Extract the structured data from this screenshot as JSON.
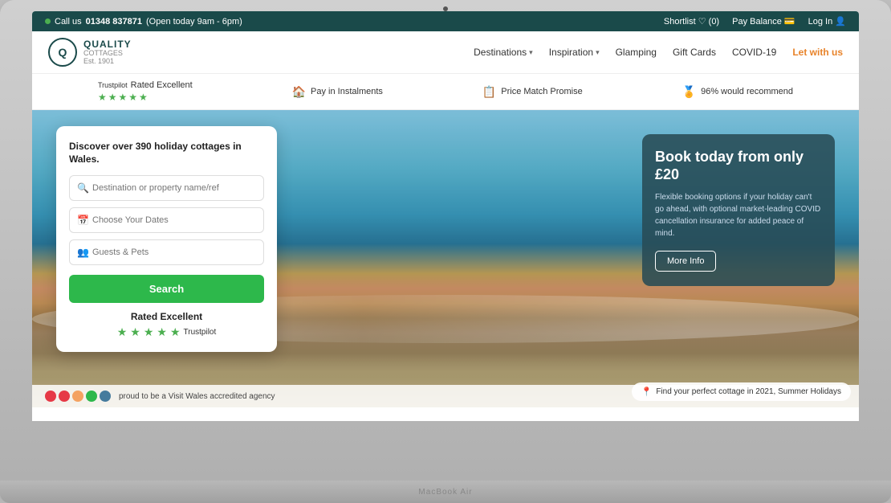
{
  "laptop": {
    "brand_label": "MacBook Air"
  },
  "topbar": {
    "call_label": "Call us",
    "phone": "01348 837871",
    "hours": "(Open today 9am - 6pm)",
    "shortlist": "Shortlist",
    "shortlist_count": "(0)",
    "pay_balance": "Pay Balance",
    "login": "Log In"
  },
  "nav": {
    "logo_letter": "Q",
    "brand_name": "QUALITY",
    "brand_sub": "COTTAGES",
    "established": "Est. 1901",
    "links": [
      {
        "label": "Destinations",
        "has_chevron": true
      },
      {
        "label": "Inspiration",
        "has_chevron": true
      },
      {
        "label": "Glamping",
        "has_chevron": false
      },
      {
        "label": "Gift Cards",
        "has_chevron": false
      },
      {
        "label": "COVID-19",
        "has_chevron": false
      },
      {
        "label": "Let with us",
        "has_chevron": false,
        "highlight": true
      }
    ]
  },
  "trustbar": {
    "items": [
      {
        "icon": "★",
        "label": "Rated Excellent",
        "type": "trustpilot"
      },
      {
        "icon": "◎",
        "label": "Pay in Instalments",
        "type": "generic"
      },
      {
        "icon": "▦",
        "label": "Price Match Promise",
        "type": "generic"
      },
      {
        "icon": "◎",
        "label": "96% would recommend",
        "type": "generic"
      }
    ]
  },
  "search_card": {
    "title": "Discover over 390 holiday cottages in Wales.",
    "destination_placeholder": "Destination or property name/ref",
    "dates_placeholder": "Choose Your Dates",
    "guests_placeholder": "Guests & Pets",
    "search_label": "Search",
    "rated_label": "Rated Excellent",
    "trustpilot_label": "Trustpilot"
  },
  "booking_box": {
    "title": "Book today from only £20",
    "description": "Flexible booking options if your holiday can't go ahead, with optional market-leading COVID cancellation insurance for added peace of mind.",
    "button_label": "More Info"
  },
  "hero_bottom": {
    "label": "Find your perfect cottage in 2021, Summer Holidays"
  },
  "bottom_strip": {
    "label": "proud to be a Visit Wales accredited agency"
  }
}
